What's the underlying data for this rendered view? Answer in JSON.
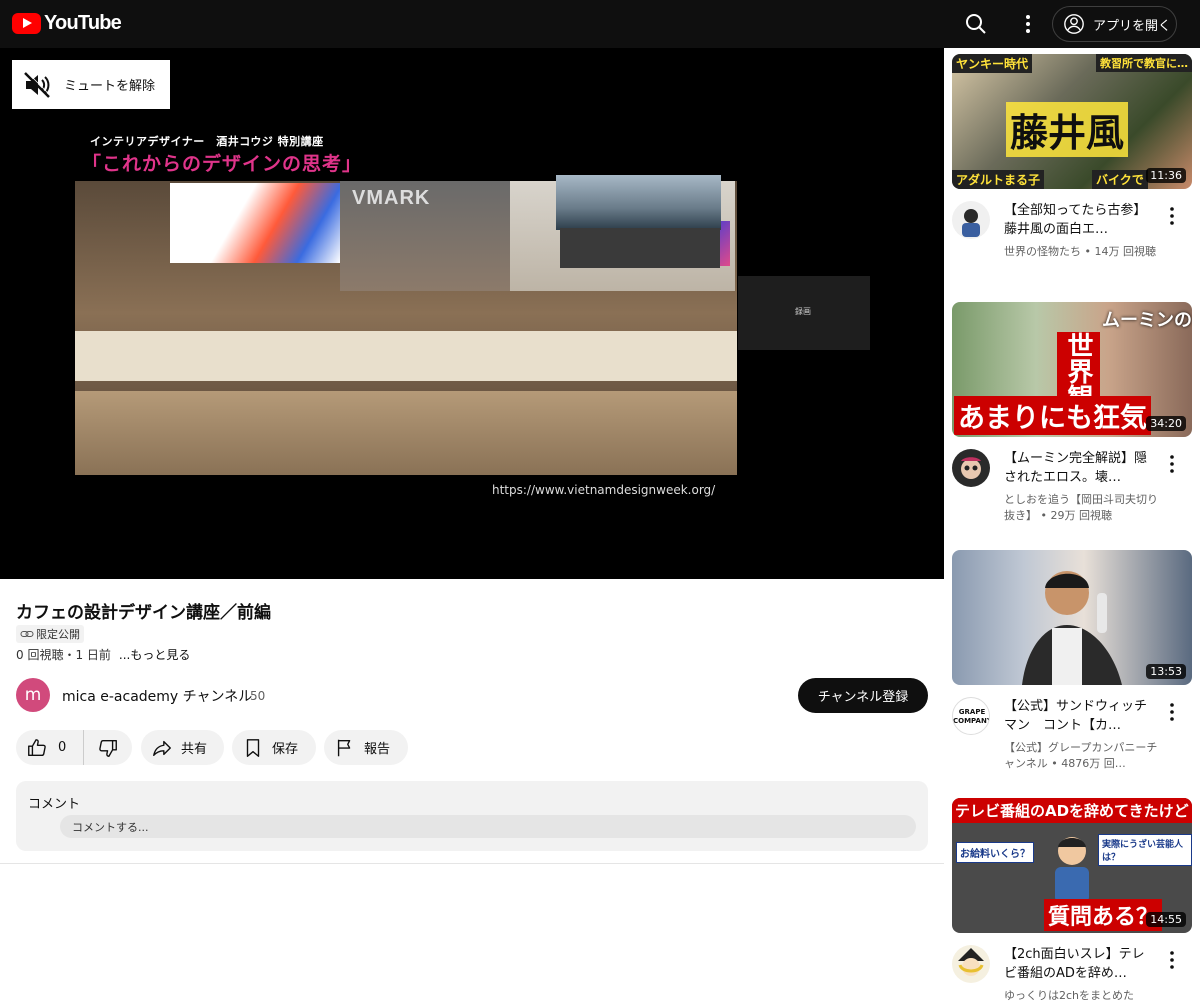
{
  "header": {
    "brand": "YouTube",
    "open_app_label": "アプリを開く"
  },
  "player": {
    "unmute_label": "ミュートを解除",
    "slide_subtitle": "インテリアデザイナー　酒井コウジ 特別講座",
    "slide_title": "「これからのデザインの思考」",
    "backdrop_text": "VMARK",
    "side_panel_text": "録画",
    "url_text": "https://www.vietnamdesignweek.org/"
  },
  "video": {
    "title": "カフェの設計デザイン講座／前編",
    "visibility_badge": "限定公開",
    "meta": "0 回視聴・1 日前",
    "more_label": "...もっと見る"
  },
  "channel": {
    "avatar_letter": "m",
    "name": "mica e-academy チャンネル",
    "subscribers": "50",
    "subscribe_label": "チャンネル登録"
  },
  "actions": {
    "like_count": "0",
    "share_label": "共有",
    "save_label": "保存",
    "report_label": "報告"
  },
  "comments": {
    "title": "コメント",
    "placeholder": "コメントする..."
  },
  "recommendations": [
    {
      "title": "【全部知ってたら古参】藤井風の面白エ…",
      "meta": "世界の怪物たち • 14万 回視聴",
      "duration": "11:36",
      "thumb_texts": [
        "ヤンキー時代",
        "教習所で教官に…",
        "藤井風",
        "アダルトまる子",
        "バイクで"
      ]
    },
    {
      "title": "【ムーミン完全解説】隠されたエロス。壊…",
      "meta": "としおを追う【岡田斗司夫切り抜き】 • 29万 回視聴",
      "duration": "34:20",
      "thumb_texts": [
        "ムーミンの",
        "世界観",
        "あまりにも狂気"
      ]
    },
    {
      "title": "【公式】サンドウィッチマン　コント【カ…",
      "meta": "【公式】グレープカンパニーチャンネル • 4876万 回…",
      "duration": "13:53",
      "avatar_text": "GRAPE COMPANY",
      "thumb_texts": []
    },
    {
      "title": "【2ch面白いスレ】テレビ番組のADを辞め…",
      "meta": "ゆっくりは2chをまとめた",
      "duration": "14:55",
      "thumb_texts": [
        "テレビ番組のADを辞めてきたけど",
        "お給料いくら？",
        "実際にうざい芸能人は？",
        "質問ある？"
      ]
    }
  ]
}
